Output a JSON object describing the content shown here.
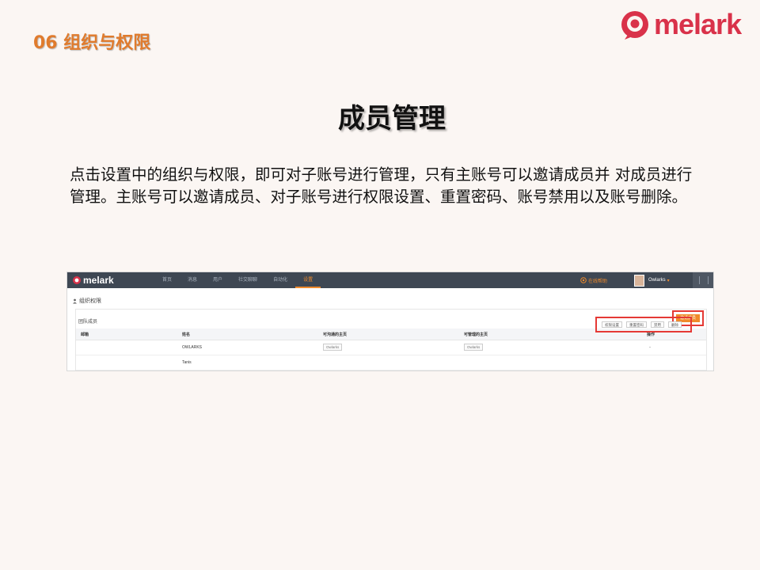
{
  "slide": {
    "section_title": "06 组织与权限",
    "logo_text": "melark",
    "heading": "成员管理",
    "body": "点击设置中的组织与权限，即可对子账号进行管理，只有主账号可以邀请成员并 对成员进行管理。主账号可以邀请成员、对子账号进行权限设置、重置密码、账号禁用以及账号删除。",
    "colors": {
      "accent": "#e07b2d",
      "brand": "#d9324a",
      "highlight_box": "#e53935"
    }
  },
  "app": {
    "brand": "melark",
    "nav": [
      "首页",
      "消息",
      "用户",
      "社交聊聊",
      "自动化",
      "设置"
    ],
    "active_nav": "设置",
    "help": "在线帮助",
    "user": "Owlarks",
    "breadcrumb": "组织权限",
    "team_title": "团队成员",
    "invite_button": "邀请成员",
    "columns": [
      "邮箱",
      "姓名",
      "可沟通的主页",
      "可管理的主页",
      "操作"
    ],
    "rows": [
      {
        "email": "",
        "name": "OWLARKS",
        "communicable_page": "Owlarks",
        "manageable_page": "Owlarks",
        "op": "-"
      },
      {
        "email": "",
        "name": "Tanis",
        "communicable_page": "",
        "manageable_page": "",
        "op": ""
      }
    ],
    "actions": [
      "权限设置",
      "重置密码",
      "禁用",
      "删除"
    ]
  }
}
